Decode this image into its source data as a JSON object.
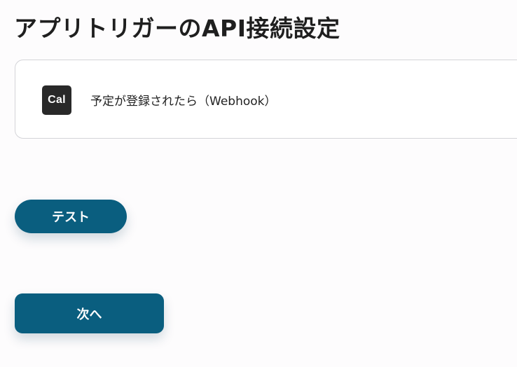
{
  "page": {
    "title": "アプリトリガーのAPI接続設定"
  },
  "trigger": {
    "app_logo_text": "Cal",
    "app_icon": "cal-logo-icon",
    "label": "予定が登録されたら（Webhook）"
  },
  "actions": {
    "test_label": "テスト",
    "next_label": "次へ"
  },
  "colors": {
    "primary_button": "#0a5e7f",
    "logo_background": "#292929",
    "card_border": "#d4d4d8"
  }
}
